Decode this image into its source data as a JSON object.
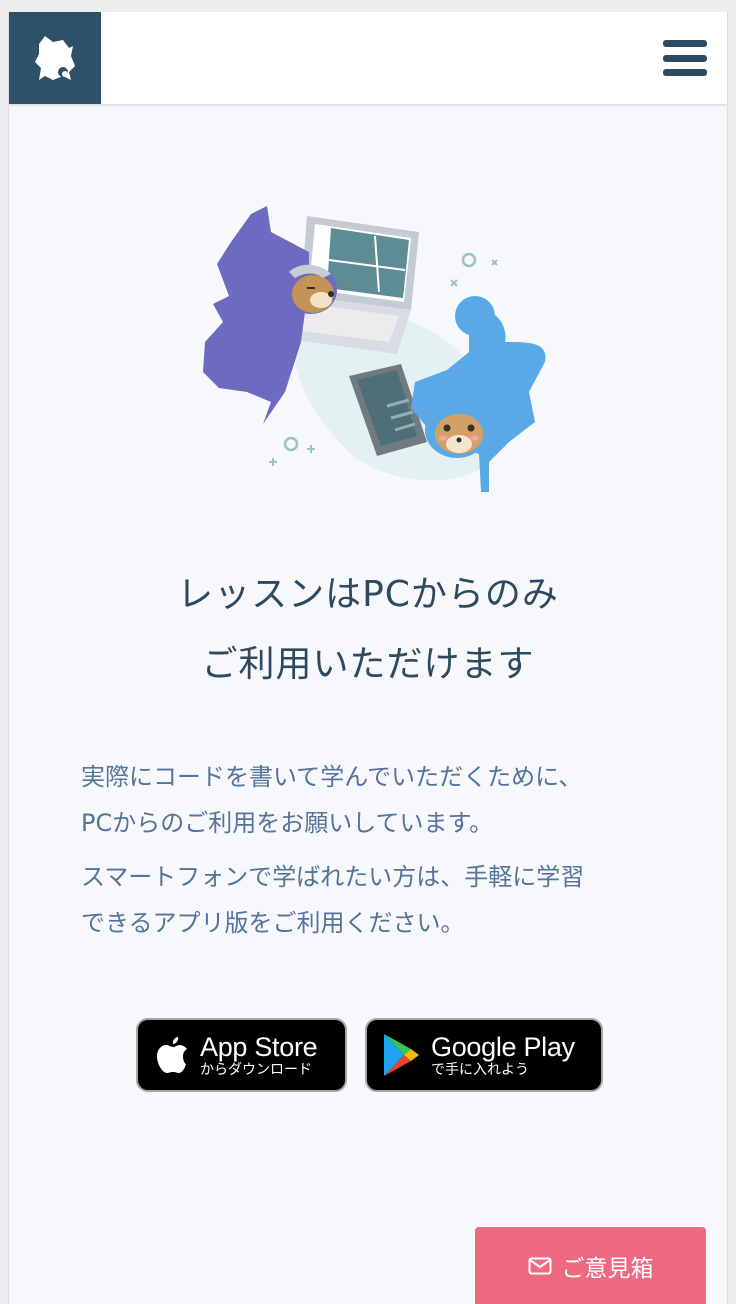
{
  "header": {
    "logo_icon": "ninja-dog-logo",
    "menu_icon": "hamburger-menu-icon"
  },
  "main": {
    "title_line1": "レッスンはPCからのみ",
    "title_line2": "ご利用いただけます",
    "desc_line1": "実際にコードを書いて学んでいただくために、",
    "desc_line2": "PCからのご利用をお願いしています。",
    "desc_line3": "スマートフォンで学ばれたい方は、手軽に学習",
    "desc_line4": "できるアプリ版をご利用ください。"
  },
  "stores": {
    "apple_main": "App Store",
    "apple_sub": "からダウンロード",
    "google_main": "Google Play",
    "google_sub": "で手に入れよう"
  },
  "feedback": {
    "label": "ご意見箱",
    "icon": "envelope-icon"
  },
  "colors": {
    "header_logo_bg": "#2e5068",
    "title": "#2f4a5e",
    "body_text": "#55739b",
    "feedback_bg": "#ee6a80"
  }
}
